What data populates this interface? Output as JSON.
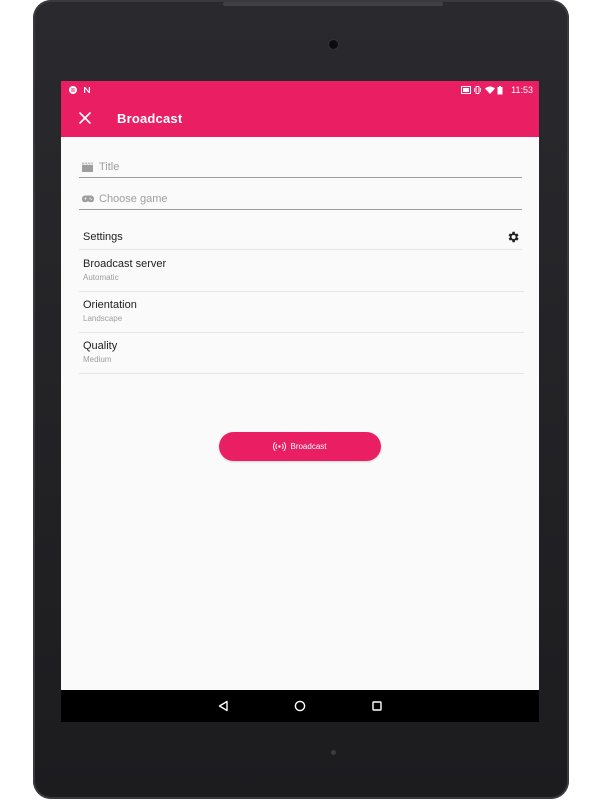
{
  "status_bar": {
    "time": "11:53",
    "left_icons": [
      "pause-circle-icon",
      "n-notification-icon"
    ],
    "right_icons": [
      "cast-icon",
      "vibrate-icon",
      "wifi-icon",
      "battery-icon"
    ]
  },
  "app_bar": {
    "title": "Broadcast",
    "close_icon": "close-icon"
  },
  "form": {
    "title_placeholder": "Title",
    "title_icon": "clapperboard-icon",
    "game_placeholder": "Choose game",
    "game_icon": "gamepad-icon"
  },
  "settings": {
    "label": "Settings",
    "icon": "gear-icon"
  },
  "preferences": [
    {
      "title": "Broadcast server",
      "value": "Automatic"
    },
    {
      "title": "Orientation",
      "value": "Landscape"
    },
    {
      "title": "Quality",
      "value": "Medium"
    }
  ],
  "broadcast_button": {
    "label": "Broadcast",
    "icon": "broadcast-icon"
  },
  "nav": {
    "back_icon": "back-icon",
    "home_icon": "home-icon",
    "recents_icon": "recents-icon"
  },
  "colors": {
    "accent": "#e91e63",
    "background": "#fafafa",
    "nav_bar": "#000000"
  }
}
